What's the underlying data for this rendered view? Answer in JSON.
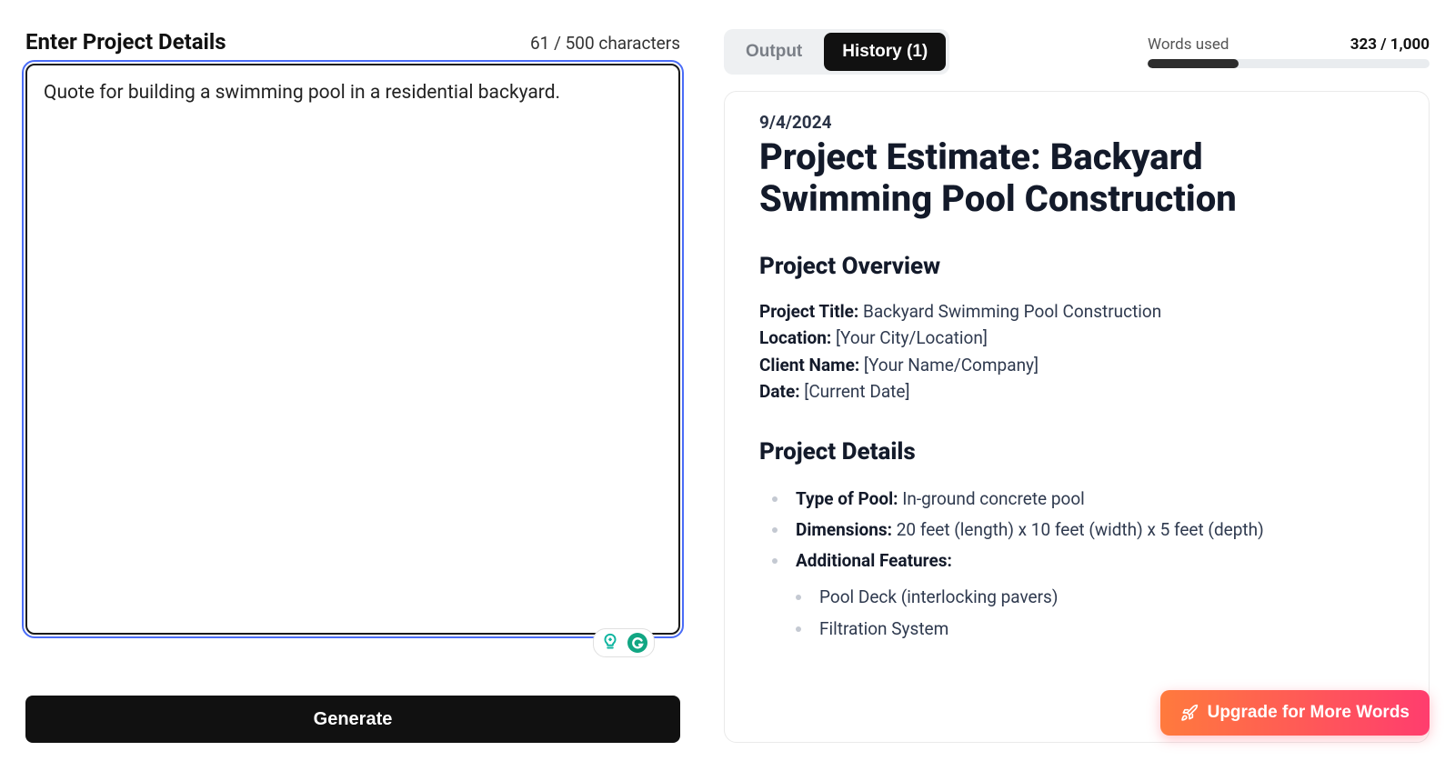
{
  "left": {
    "title": "Enter Project Details",
    "char_count": "61 / 500 characters",
    "textarea_value": "Quote for building a swimming pool in a residential backyard.",
    "generate_label": "Generate"
  },
  "tabs": {
    "output": "Output",
    "history": "History (1)"
  },
  "words": {
    "label": "Words used",
    "count": "323 / 1,000",
    "percent": 32.3
  },
  "output": {
    "date": "9/4/2024",
    "title": "Project Estimate: Backyard Swimming Pool Construction",
    "overview_heading": "Project Overview",
    "overview": {
      "project_title_k": "Project Title:",
      "project_title_v": "Backyard Swimming Pool Construction",
      "location_k": "Location:",
      "location_v": "[Your City/Location]",
      "client_k": "Client Name:",
      "client_v": "[Your Name/Company]",
      "date_k": "Date:",
      "date_v": "[Current Date]"
    },
    "details_heading": "Project Details",
    "details": {
      "type_k": "Type of Pool:",
      "type_v": "In-ground concrete pool",
      "dim_k": "Dimensions:",
      "dim_v": "20 feet (length) x 10 feet (width) x 5 feet (depth)",
      "addl_k": "Additional Features:",
      "feat1": "Pool Deck (interlocking pavers)",
      "feat2": "Filtration System"
    }
  },
  "upgrade_label": "Upgrade for More Words"
}
